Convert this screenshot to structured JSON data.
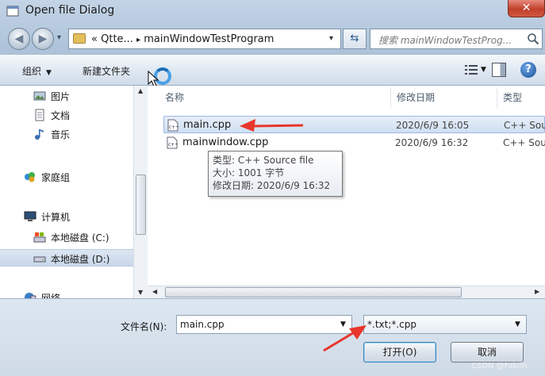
{
  "window": {
    "title": "Open file Dialog",
    "close_glyph": "✕"
  },
  "address": {
    "chevron": "«",
    "path": [
      "Qtte...",
      "mainWindowTestProgram"
    ],
    "separator": "▸",
    "search_placeholder": "搜索 mainWindowTestProg..."
  },
  "commands": {
    "organize": "组织",
    "new_folder": "新建文件夹"
  },
  "nav": {
    "items": [
      {
        "label": "图片",
        "icon": "pictures-icon"
      },
      {
        "label": "文档",
        "icon": "documents-icon"
      },
      {
        "label": "音乐",
        "icon": "music-icon"
      },
      {
        "label": "家庭组",
        "icon": "homegroup-icon"
      },
      {
        "label": "计算机",
        "icon": "computer-icon"
      },
      {
        "label": "本地磁盘 (C:)",
        "icon": "drive-c-icon"
      },
      {
        "label": "本地磁盘 (D:)",
        "icon": "drive-d-icon",
        "selected": true
      },
      {
        "label": "网络",
        "icon": "network-icon"
      }
    ]
  },
  "files": {
    "columns": {
      "name": "名称",
      "date": "修改日期",
      "type": "类型"
    },
    "rows": [
      {
        "name": "main.cpp",
        "date": "2020/6/9 16:05",
        "type": "C++ Sou"
      },
      {
        "name": "mainwindow.cpp",
        "date": "2020/6/9 16:32",
        "type": "C++ Sou"
      }
    ]
  },
  "tooltip": {
    "type": "类型: C++ Source file",
    "size": "大小: 1001 字节",
    "modified": "修改日期: 2020/6/9 16:32"
  },
  "bottom": {
    "filename_label": "文件名(N):",
    "filename_value": "main.cpp",
    "filter_value": "*.txt;*.cpp",
    "open_button": "打开(O)",
    "cancel_button": "取消"
  },
  "watermark": "CSDN @Fakiln",
  "colors": {
    "accent": "#3c7fb1",
    "annotation_arrow": "#e8362c",
    "close": "#c0412b"
  }
}
